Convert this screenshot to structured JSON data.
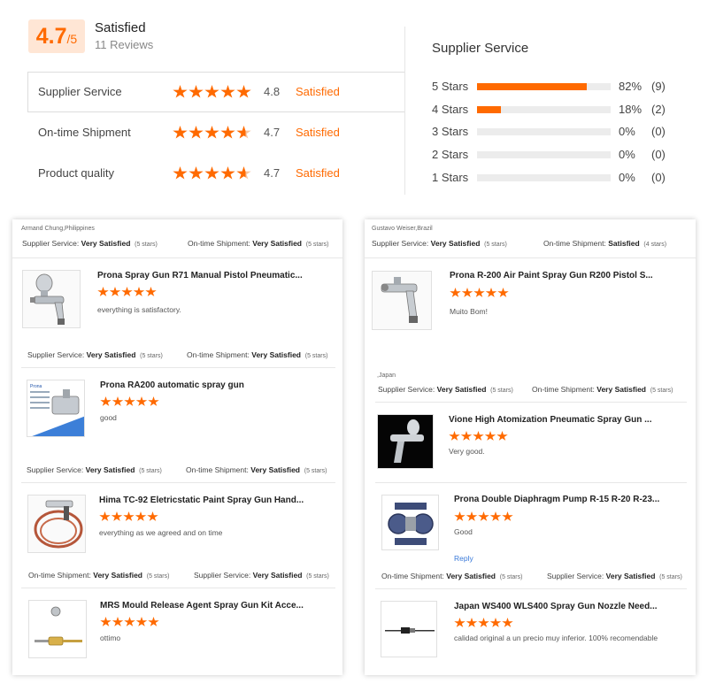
{
  "summary": {
    "score": "4.7",
    "score_suffix": "/5",
    "overall_label": "Satisfied",
    "reviews": "11 Reviews"
  },
  "rating_rows": [
    {
      "label": "Supplier Service",
      "score": "4.8",
      "text": "Satisfied",
      "stars": 5
    },
    {
      "label": "On-time Shipment",
      "score": "4.7",
      "text": "Satisfied",
      "stars": 4.7
    },
    {
      "label": "Product quality",
      "score": "4.7",
      "text": "Satisfied",
      "stars": 4.7
    }
  ],
  "distribution": {
    "title": "Supplier Service",
    "rows": [
      {
        "label": "5  Stars",
        "percent": 82,
        "pct_text": "82%",
        "count": "(9)"
      },
      {
        "label": "4  Stars",
        "percent": 18,
        "pct_text": "18%",
        "count": "(2)"
      },
      {
        "label": "3  Stars",
        "percent": 0,
        "pct_text": "0%",
        "count": "(0)"
      },
      {
        "label": "2  Stars",
        "percent": 0,
        "pct_text": "0%",
        "count": "(0)"
      },
      {
        "label": "1  Stars",
        "percent": 0,
        "pct_text": "0%",
        "count": "(0)"
      }
    ]
  },
  "left_panel": {
    "reviewer": "Armand Chung,Philippines",
    "header": {
      "supplier_label": "Supplier Service:",
      "supplier_value": "Very Satisfied",
      "supplier_stars": "(5 stars)",
      "shipment_label": "On-time Shipment:",
      "shipment_value": "Very Satisfied",
      "shipment_stars": "(5 stars)"
    },
    "items": [
      {
        "title": "Prona Spray Gun R71 Manual Pistol Pneumatic...",
        "comment": "everything is satisfactory.",
        "rating": 5
      },
      {
        "title": "Prona RA200 automatic spray gun",
        "comment": "good",
        "rating": 5
      },
      {
        "title": "Hima TC-92 Eletricstatic Paint Spray Gun Hand...",
        "comment": "everything as we agreed and on time",
        "rating": 5
      },
      {
        "title": "MRS Mould Release Agent Spray Gun Kit Acce...",
        "comment": "ottimo",
        "rating": 5
      }
    ],
    "between": [
      {
        "a_label": "Supplier Service:",
        "a_value": "Very Satisfied",
        "a_stars": "(5 stars)",
        "b_label": "On-time Shipment:",
        "b_value": "Very Satisfied",
        "b_stars": "(5 stars)"
      },
      {
        "a_label": "Supplier Service:",
        "a_value": "Very Satisfied",
        "a_stars": "(5 stars)",
        "b_label": "On-time Shipment:",
        "b_value": "Very Satisfied",
        "b_stars": "(5 stars)"
      },
      {
        "a_label": "On-time Shipment:",
        "a_value": "Very Satisfied",
        "a_stars": "(5 stars)",
        "b_label": "Supplier Service:",
        "b_value": "Very Satisfied",
        "b_stars": "(5 stars)"
      }
    ]
  },
  "right_panel": {
    "reviewer": "Gustavo Weiser,Brazil",
    "header": {
      "supplier_label": "Supplier Service:",
      "supplier_value": "Very Satisfied",
      "supplier_stars": "(5 stars)",
      "shipment_label": "On-time Shipment:",
      "shipment_value": "Satisfied",
      "shipment_stars": "(4 stars)"
    },
    "reviewer2": ",Japan",
    "header2": {
      "supplier_label": "Supplier Service:",
      "supplier_value": "Very Satisfied",
      "supplier_stars": "(5 stars)",
      "shipment_label": "On-time Shipment:",
      "shipment_value": "Very Satisfied",
      "shipment_stars": "(5 stars)"
    },
    "items": [
      {
        "title": "Prona R-200 Air Paint Spray Gun R200 Pistol S...",
        "comment": "Muito Bom!",
        "rating": 5
      },
      {
        "title": "Vione High Atomization Pneumatic Spray Gun ...",
        "comment": "Very good.",
        "rating": 5
      },
      {
        "title": "Prona Double Diaphragm Pump R-15 R-20 R-23...",
        "comment": "Good",
        "rating": 5,
        "reply": "Reply"
      },
      {
        "title": "Japan WS400 WLS400 Spray Gun Nozzle Need...",
        "comment": "calidad original a un precio muy inferior. 100% recomendable",
        "rating": 5
      }
    ],
    "between": {
      "a_label": "On-time Shipment:",
      "a_value": "Very Satisfied",
      "a_stars": "(5 stars)",
      "b_label": "Supplier Service:",
      "b_value": "Very Satisfied",
      "b_stars": "(5 stars)"
    }
  },
  "colors": {
    "accent": "#ff6a00",
    "badge_bg": "#ffe6d5",
    "bar_bg": "#ececec"
  }
}
